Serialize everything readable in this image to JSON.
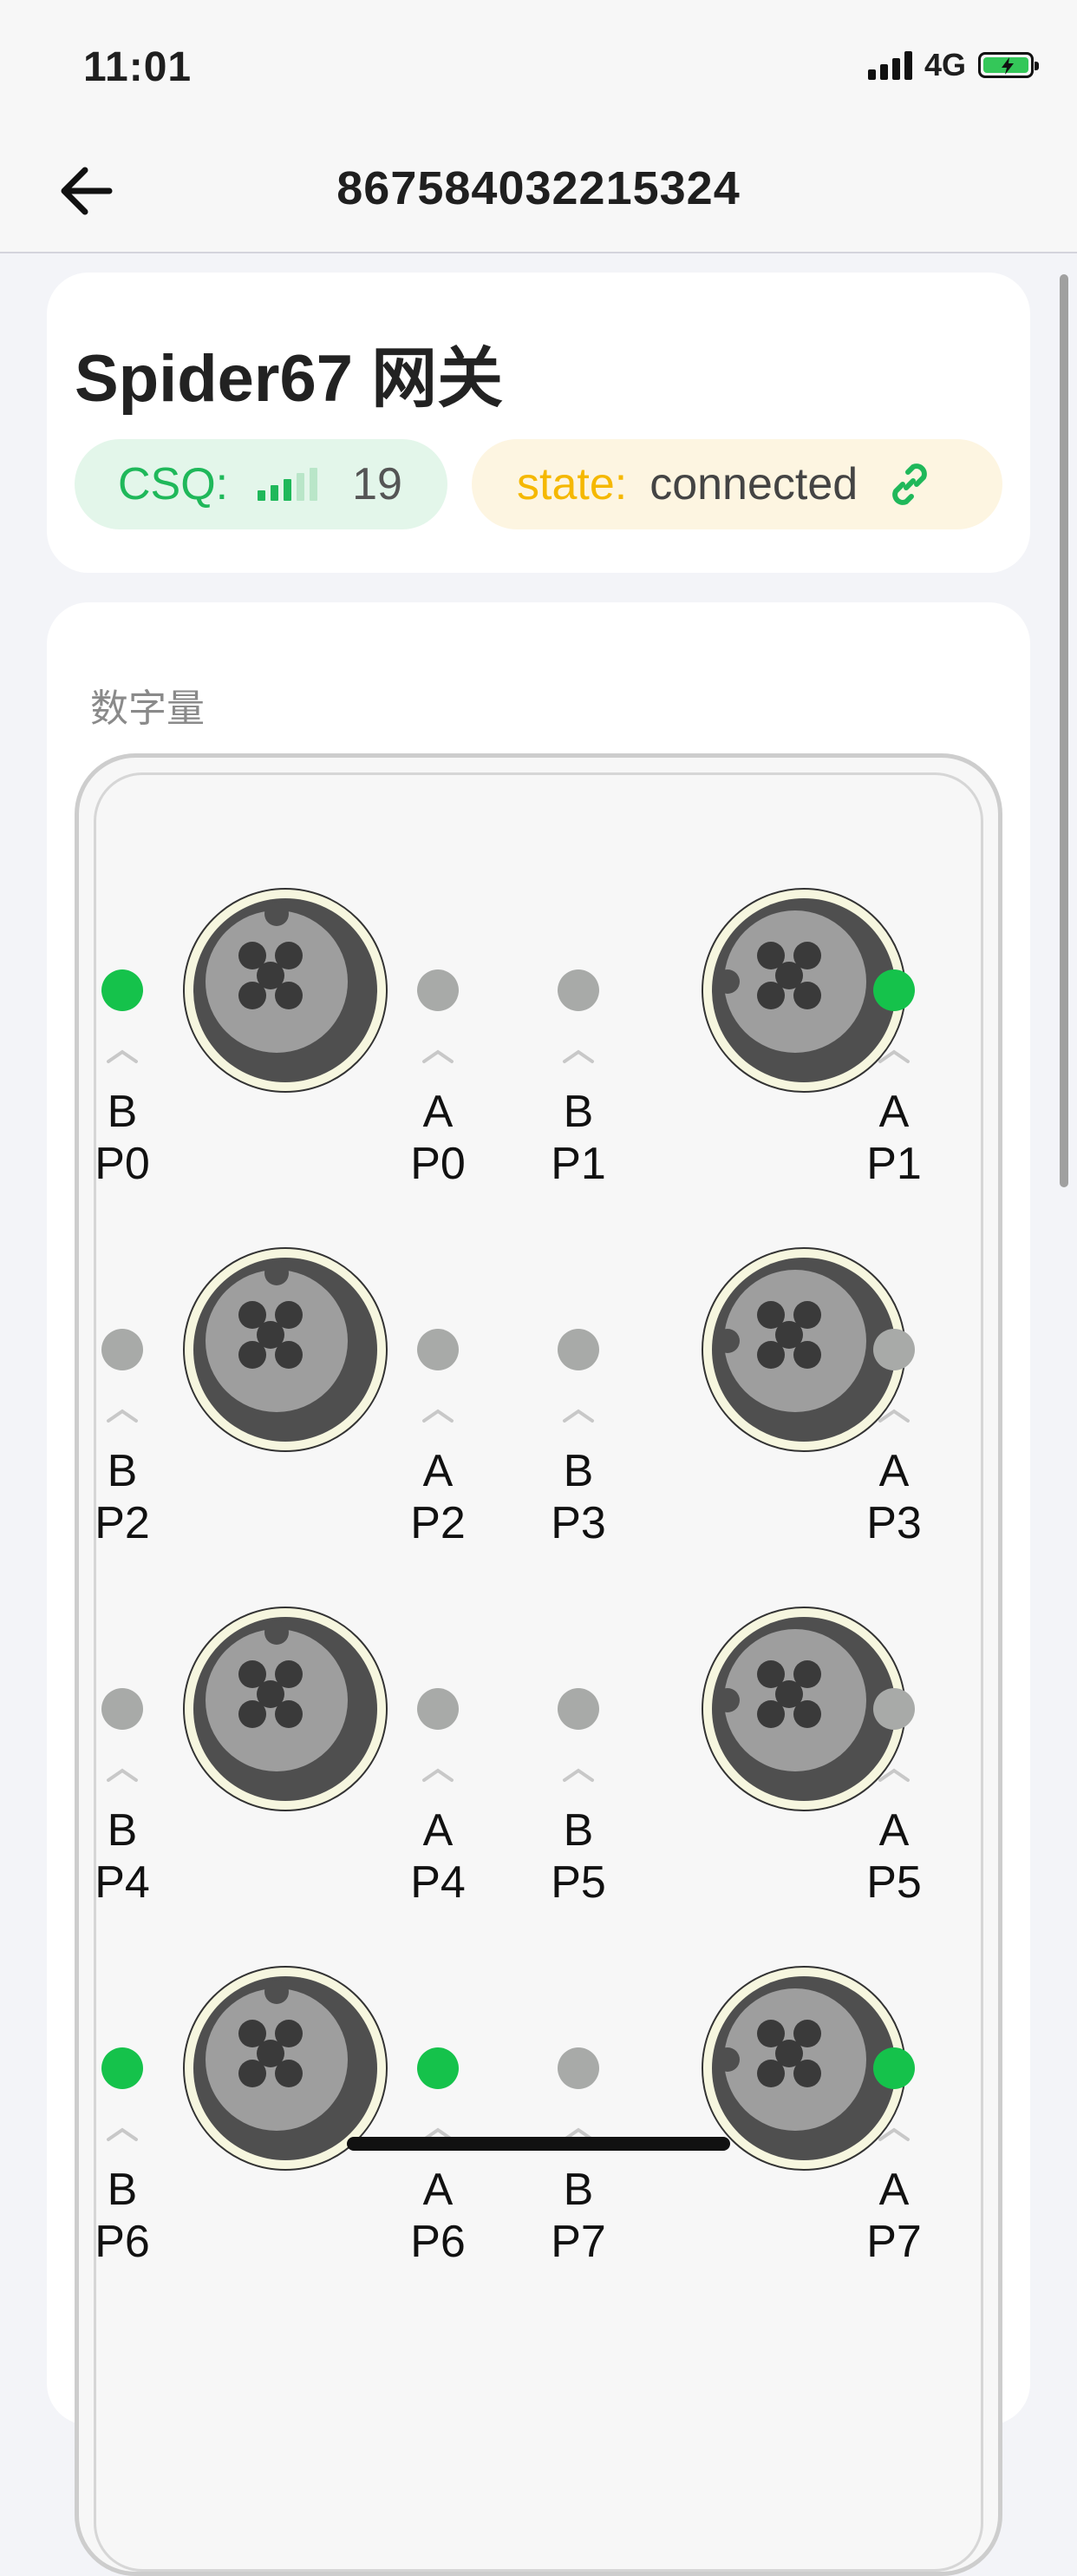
{
  "status_bar": {
    "time": "11:01",
    "network": "4G",
    "icons": [
      "signal-icon",
      "battery-charging-icon"
    ]
  },
  "nav": {
    "title": "867584032215324",
    "back_icon": "arrow-left-icon"
  },
  "device": {
    "title": "Spider67 网关",
    "csq": {
      "label": "CSQ:",
      "value": "19",
      "bars_active": 3,
      "bars_total": 5,
      "icon": "signal-strength-icon"
    },
    "state": {
      "label": "state:",
      "value": "connected",
      "icon": "link-icon"
    }
  },
  "io": {
    "section_title": "数字量",
    "ports": [
      {
        "name": "P0",
        "b_label": "B",
        "a_label": "A",
        "b_name": "P0",
        "a_name": "P0",
        "b_on": true,
        "a_on": false,
        "key": "top"
      },
      {
        "name": "P1",
        "b_label": "B",
        "a_label": "A",
        "b_name": "P1",
        "a_name": "P1",
        "b_on": false,
        "a_on": true,
        "key": "left"
      },
      {
        "name": "P2",
        "b_label": "B",
        "a_label": "A",
        "b_name": "P2",
        "a_name": "P2",
        "b_on": false,
        "a_on": false,
        "key": "top"
      },
      {
        "name": "P3",
        "b_label": "B",
        "a_label": "A",
        "b_name": "P3",
        "a_name": "P3",
        "b_on": false,
        "a_on": false,
        "key": "left"
      },
      {
        "name": "P4",
        "b_label": "B",
        "a_label": "A",
        "b_name": "P4",
        "a_name": "P4",
        "b_on": false,
        "a_on": false,
        "key": "top"
      },
      {
        "name": "P5",
        "b_label": "B",
        "a_label": "A",
        "b_name": "P5",
        "a_name": "P5",
        "b_on": false,
        "a_on": false,
        "key": "left"
      },
      {
        "name": "P6",
        "b_label": "B",
        "a_label": "A",
        "b_name": "P6",
        "a_name": "P6",
        "b_on": true,
        "a_on": true,
        "key": "top"
      },
      {
        "name": "P7",
        "b_label": "B",
        "a_label": "A",
        "b_name": "P7",
        "a_name": "P7",
        "b_on": false,
        "a_on": true,
        "key": "left"
      }
    ]
  },
  "colors": {
    "led_on": "#15c24b",
    "led_off": "#a8aaa8",
    "csq_green": "#1fb85a",
    "state_yellow": "#f5b800"
  }
}
